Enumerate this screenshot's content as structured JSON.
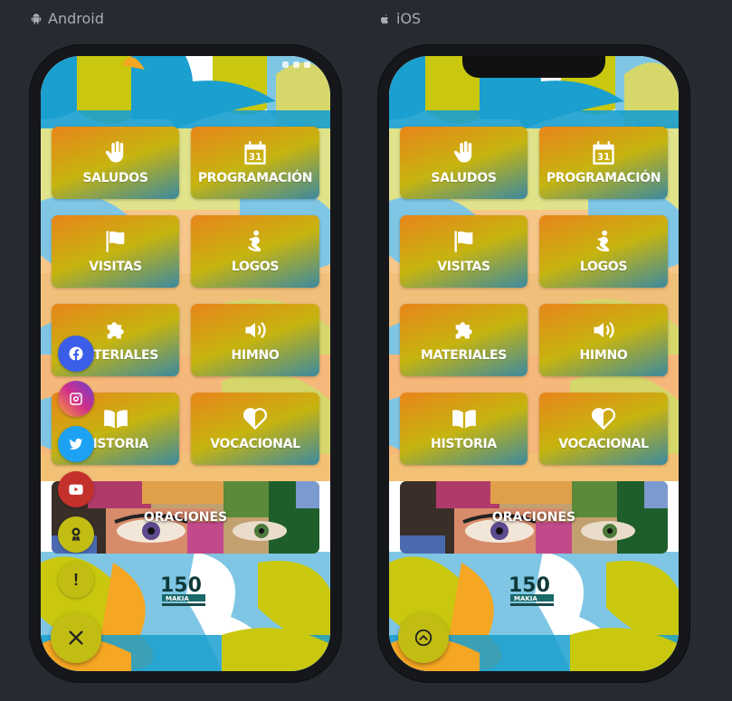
{
  "labels": {
    "android": "Android",
    "ios": "iOS"
  },
  "menu": {
    "saludos": "SALUDOS",
    "programacion": "PROGRAMACIÓN",
    "calendar_day": "31",
    "visitas": "VISITAS",
    "logos": "LOGOS",
    "materiales": "MATERIALES",
    "himno": "HIMNO",
    "historia": "HISTORIA",
    "vocacional": "VOCACIONAL",
    "oraciones": "ORACIONES"
  },
  "social": {
    "items": [
      "facebook-icon",
      "instagram-icon",
      "twitter-icon",
      "youtube-icon",
      "award-icon",
      "alert-icon"
    ],
    "colors": {
      "facebook": "#3b5ee8",
      "instagram": "#c8357a",
      "twitter": "#1da1f2",
      "youtube": "#c4302b",
      "award": "#c2bd12",
      "alert": "#c2bd12"
    },
    "alert_glyph": "!",
    "close_glyph": "×"
  },
  "colors": {
    "tile_gradient_start": "#e8851a",
    "tile_gradient_mid": "#c6b410",
    "tile_gradient_end": "#3b8aa0",
    "fab": "#c2bd12",
    "background": "#272a31"
  }
}
